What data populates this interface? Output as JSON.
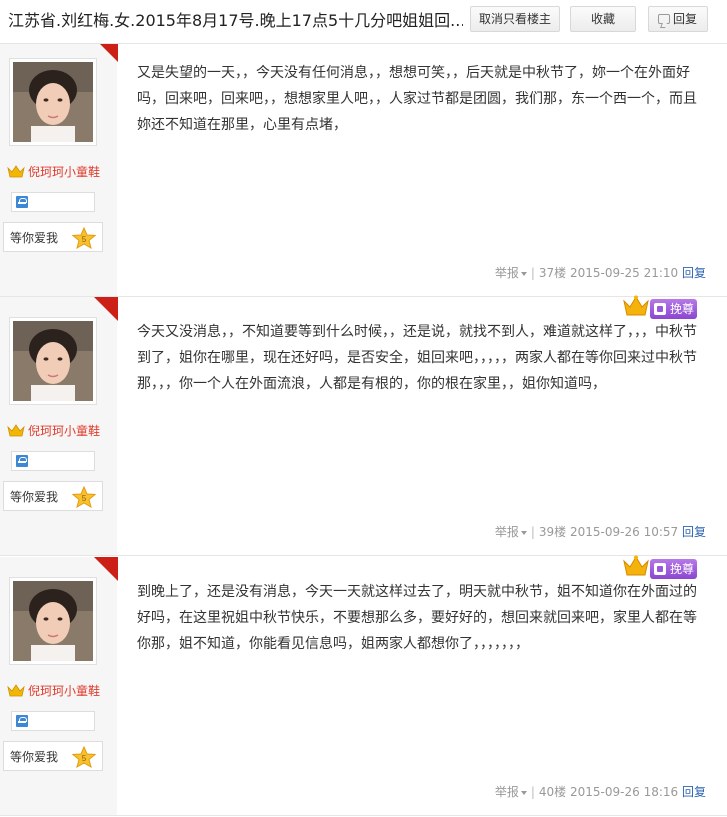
{
  "header": {
    "title": "江苏省.刘红梅.女.2015年8月17号.晚上17点5十几分吧姐姐回...",
    "only_author_label": "取消只看楼主",
    "favorite_label": "收藏",
    "reply_label": "回复"
  },
  "user": {
    "name": "倪珂珂小童鞋",
    "badge_label": "等你爱我",
    "badge_level": "5"
  },
  "author_tag": "楼主",
  "vip_label": "挽尊",
  "posts": [
    {
      "content": "又是失望的一天，，今天没有任何消息，，想想可笑，，后天就是中秋节了，妳一个在外面好吗，回来吧，回来吧，，想想家里人吧，，人家过节都是团圆，我们那，东一个西一个，而且妳还不知道在那里，心里有点堵，",
      "report_label": "举报",
      "floor": "37楼",
      "time": "2015-09-25 21:10",
      "reply_label": "回复"
    },
    {
      "content": "今天又没消息，，不知道要等到什么时候，，还是说，就找不到人，难道就这样了，，，中秋节到了，姐你在哪里，现在还好吗，是否安全，姐回来吧，，，，，两家人都在等你回来过中秋节那，，，你一个人在外面流浪，人都是有根的，你的根在家里，，姐你知道吗，",
      "report_label": "举报",
      "floor": "39楼",
      "time": "2015-09-26 10:57",
      "reply_label": "回复"
    },
    {
      "content": "到晚上了，还是没有消息，今天一天就这样过去了，明天就中秋节，姐不知道你在外面过的好吗，在这里祝姐中秋节快乐，不要想那么多，要好好的，想回来就回来吧，家里人都在等你那，姐不知道，你能看见信息吗，姐两家人都想你了，，，，，，，",
      "report_label": "举报",
      "floor": "40楼",
      "time": "2015-09-26 18:16",
      "reply_label": "回复"
    }
  ]
}
